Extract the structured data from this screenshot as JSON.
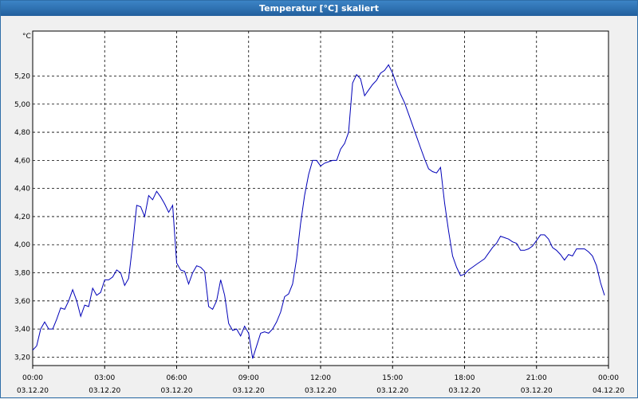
{
  "window": {
    "title": "Temperatur [°C] skaliert"
  },
  "colors": {
    "title_bar": "#2566a8",
    "plot_background": "#ffffff",
    "grid": "#000000",
    "line": "#0000b8"
  },
  "chart_data": {
    "type": "line",
    "title": "Temperatur [°C] skaliert",
    "unit": "°C",
    "grid": true,
    "grid_style": "dashed",
    "ylim": [
      3.14,
      5.52
    ],
    "y_ticks": [
      {
        "value": 3.2,
        "label": "3,20"
      },
      {
        "value": 3.4,
        "label": "3,40"
      },
      {
        "value": 3.6,
        "label": "3,60"
      },
      {
        "value": 3.8,
        "label": "3,80"
      },
      {
        "value": 4.0,
        "label": "4,00"
      },
      {
        "value": 4.2,
        "label": "4,20"
      },
      {
        "value": 4.4,
        "label": "4,40"
      },
      {
        "value": 4.6,
        "label": "4,60"
      },
      {
        "value": 4.8,
        "label": "4,80"
      },
      {
        "value": 5.0,
        "label": "5,00"
      },
      {
        "value": 5.2,
        "label": "5,20"
      }
    ],
    "xlim": [
      "03.12.20 00:00",
      "04.12.20 00:00"
    ],
    "x_ticks": [
      {
        "time": "00:00",
        "date": "03.12.20"
      },
      {
        "time": "03:00",
        "date": "03.12.20"
      },
      {
        "time": "06:00",
        "date": "03.12.20"
      },
      {
        "time": "09:00",
        "date": "03.12.20"
      },
      {
        "time": "12:00",
        "date": "03.12.20"
      },
      {
        "time": "15:00",
        "date": "03.12.20"
      },
      {
        "time": "18:00",
        "date": "03.12.20"
      },
      {
        "time": "21:00",
        "date": "03.12.20"
      },
      {
        "time": "00:00",
        "date": "04.12.20"
      }
    ],
    "series": [
      {
        "points": [
          [
            "03.12.20 00:00",
            3.25
          ],
          [
            "03.12.20 00:10",
            3.28
          ],
          [
            "03.12.20 00:20",
            3.4
          ],
          [
            "03.12.20 00:30",
            3.45
          ],
          [
            "03.12.20 00:40",
            3.4
          ],
          [
            "03.12.20 00:50",
            3.4
          ],
          [
            "03.12.20 01:00",
            3.47
          ],
          [
            "03.12.20 01:10",
            3.55
          ],
          [
            "03.12.20 01:20",
            3.54
          ],
          [
            "03.12.20 01:30",
            3.6
          ],
          [
            "03.12.20 01:40",
            3.68
          ],
          [
            "03.12.20 01:50",
            3.6
          ],
          [
            "03.12.20 02:00",
            3.49
          ],
          [
            "03.12.20 02:10",
            3.57
          ],
          [
            "03.12.20 02:20",
            3.56
          ],
          [
            "03.12.20 02:30",
            3.69
          ],
          [
            "03.12.20 02:40",
            3.64
          ],
          [
            "03.12.20 02:50",
            3.66
          ],
          [
            "03.12.20 03:00",
            3.75
          ],
          [
            "03.12.20 03:10",
            3.75
          ],
          [
            "03.12.20 03:20",
            3.77
          ],
          [
            "03.12.20 03:30",
            3.82
          ],
          [
            "03.12.20 03:40",
            3.8
          ],
          [
            "03.12.20 03:50",
            3.71
          ],
          [
            "03.12.20 04:00",
            3.76
          ],
          [
            "03.12.20 04:10",
            4.0
          ],
          [
            "03.12.20 04:20",
            4.28
          ],
          [
            "03.12.20 04:30",
            4.27
          ],
          [
            "03.12.20 04:40",
            4.2
          ],
          [
            "03.12.20 04:50",
            4.35
          ],
          [
            "03.12.20 05:00",
            4.32
          ],
          [
            "03.12.20 05:10",
            4.38
          ],
          [
            "03.12.20 05:20",
            4.34
          ],
          [
            "03.12.20 05:30",
            4.29
          ],
          [
            "03.12.20 05:40",
            4.23
          ],
          [
            "03.12.20 05:50",
            4.28
          ],
          [
            "03.12.20 06:00",
            3.87
          ],
          [
            "03.12.20 06:10",
            3.82
          ],
          [
            "03.12.20 06:20",
            3.81
          ],
          [
            "03.12.20 06:30",
            3.72
          ],
          [
            "03.12.20 06:40",
            3.8
          ],
          [
            "03.12.20 06:50",
            3.85
          ],
          [
            "03.12.20 07:00",
            3.84
          ],
          [
            "03.12.20 07:10",
            3.81
          ],
          [
            "03.12.20 07:20",
            3.56
          ],
          [
            "03.12.20 07:30",
            3.54
          ],
          [
            "03.12.20 07:40",
            3.6
          ],
          [
            "03.12.20 07:50",
            3.75
          ],
          [
            "03.12.20 08:00",
            3.64
          ],
          [
            "03.12.20 08:10",
            3.44
          ],
          [
            "03.12.20 08:20",
            3.39
          ],
          [
            "03.12.20 08:30",
            3.4
          ],
          [
            "03.12.20 08:40",
            3.35
          ],
          [
            "03.12.20 08:50",
            3.42
          ],
          [
            "03.12.20 09:00",
            3.37
          ],
          [
            "03.12.20 09:10",
            3.19
          ],
          [
            "03.12.20 09:20",
            3.28
          ],
          [
            "03.12.20 09:30",
            3.37
          ],
          [
            "03.12.20 09:40",
            3.38
          ],
          [
            "03.12.20 09:50",
            3.37
          ],
          [
            "03.12.20 10:00",
            3.4
          ],
          [
            "03.12.20 10:10",
            3.45
          ],
          [
            "03.12.20 10:20",
            3.52
          ],
          [
            "03.12.20 10:30",
            3.63
          ],
          [
            "03.12.20 10:40",
            3.65
          ],
          [
            "03.12.20 10:50",
            3.72
          ],
          [
            "03.12.20 11:00",
            3.9
          ],
          [
            "03.12.20 11:10",
            4.15
          ],
          [
            "03.12.20 11:20",
            4.35
          ],
          [
            "03.12.20 11:30",
            4.5
          ],
          [
            "03.12.20 11:40",
            4.6
          ],
          [
            "03.12.20 11:50",
            4.6
          ],
          [
            "03.12.20 12:00",
            4.56
          ],
          [
            "03.12.20 12:10",
            4.58
          ],
          [
            "03.12.20 12:20",
            4.59
          ],
          [
            "03.12.20 12:30",
            4.6
          ],
          [
            "03.12.20 12:40",
            4.6
          ],
          [
            "03.12.20 12:50",
            4.68
          ],
          [
            "03.12.20 13:00",
            4.72
          ],
          [
            "03.12.20 13:10",
            4.8
          ],
          [
            "03.12.20 13:20",
            5.15
          ],
          [
            "03.12.20 13:30",
            5.21
          ],
          [
            "03.12.20 13:40",
            5.18
          ],
          [
            "03.12.20 13:50",
            5.06
          ],
          [
            "03.12.20 14:00",
            5.1
          ],
          [
            "03.12.20 14:10",
            5.14
          ],
          [
            "03.12.20 14:20",
            5.17
          ],
          [
            "03.12.20 14:30",
            5.22
          ],
          [
            "03.12.20 14:40",
            5.24
          ],
          [
            "03.12.20 14:50",
            5.28
          ],
          [
            "03.12.20 15:00",
            5.22
          ],
          [
            "03.12.20 15:10",
            5.14
          ],
          [
            "03.12.20 15:20",
            5.07
          ],
          [
            "03.12.20 15:30",
            5.01
          ],
          [
            "03.12.20 15:40",
            4.93
          ],
          [
            "03.12.20 15:50",
            4.85
          ],
          [
            "03.12.20 16:00",
            4.77
          ],
          [
            "03.12.20 16:10",
            4.69
          ],
          [
            "03.12.20 16:20",
            4.61
          ],
          [
            "03.12.20 16:30",
            4.54
          ],
          [
            "03.12.20 16:40",
            4.52
          ],
          [
            "03.12.20 16:50",
            4.51
          ],
          [
            "03.12.20 17:00",
            4.55
          ],
          [
            "03.12.20 17:10",
            4.3
          ],
          [
            "03.12.20 17:20",
            4.1
          ],
          [
            "03.12.20 17:30",
            3.92
          ],
          [
            "03.12.20 17:40",
            3.84
          ],
          [
            "03.12.20 17:50",
            3.78
          ],
          [
            "03.12.20 18:00",
            3.79
          ],
          [
            "03.12.20 18:10",
            3.82
          ],
          [
            "03.12.20 18:20",
            3.84
          ],
          [
            "03.12.20 18:30",
            3.86
          ],
          [
            "03.12.20 18:40",
            3.88
          ],
          [
            "03.12.20 18:50",
            3.9
          ],
          [
            "03.12.20 19:00",
            3.94
          ],
          [
            "03.12.20 19:10",
            3.98
          ],
          [
            "03.12.20 19:20",
            4.01
          ],
          [
            "03.12.20 19:30",
            4.06
          ],
          [
            "03.12.20 19:40",
            4.05
          ],
          [
            "03.12.20 19:50",
            4.04
          ],
          [
            "03.12.20 20:00",
            4.02
          ],
          [
            "03.12.20 20:10",
            4.01
          ],
          [
            "03.12.20 20:20",
            3.96
          ],
          [
            "03.12.20 20:30",
            3.96
          ],
          [
            "03.12.20 20:40",
            3.97
          ],
          [
            "03.12.20 20:50",
            3.99
          ],
          [
            "03.12.20 21:00",
            4.03
          ],
          [
            "03.12.20 21:10",
            4.07
          ],
          [
            "03.12.20 21:20",
            4.07
          ],
          [
            "03.12.20 21:30",
            4.04
          ],
          [
            "03.12.20 21:40",
            3.98
          ],
          [
            "03.12.20 21:50",
            3.96
          ],
          [
            "03.12.20 22:00",
            3.93
          ],
          [
            "03.12.20 22:10",
            3.89
          ],
          [
            "03.12.20 22:20",
            3.93
          ],
          [
            "03.12.20 22:30",
            3.92
          ],
          [
            "03.12.20 22:40",
            3.97
          ],
          [
            "03.12.20 22:50",
            3.97
          ],
          [
            "03.12.20 23:00",
            3.97
          ],
          [
            "03.12.20 23:10",
            3.95
          ],
          [
            "03.12.20 23:20",
            3.92
          ],
          [
            "03.12.20 23:30",
            3.85
          ],
          [
            "03.12.20 23:40",
            3.73
          ],
          [
            "03.12.20 23:50",
            3.64
          ]
        ]
      }
    ]
  }
}
